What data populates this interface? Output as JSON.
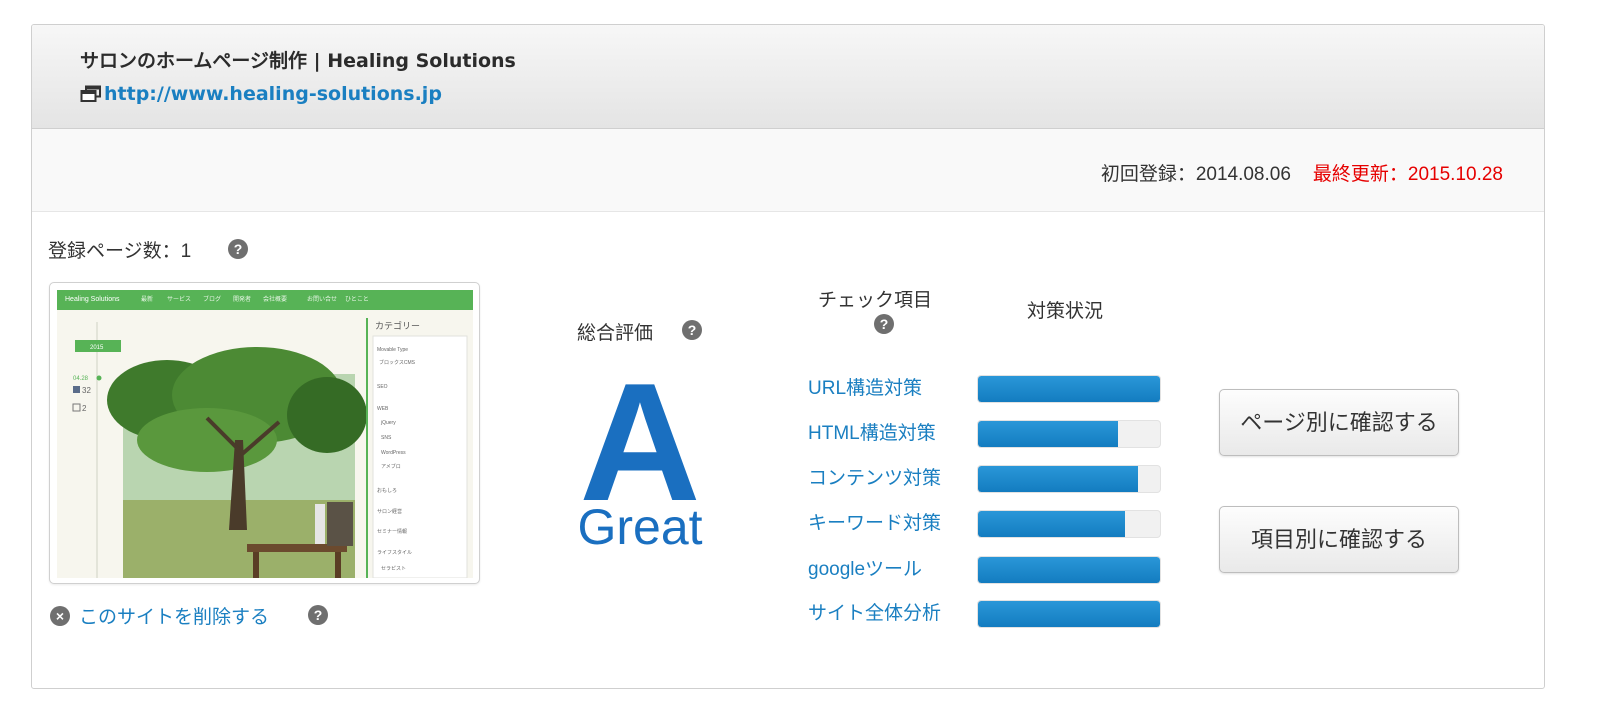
{
  "header": {
    "site_title": "サロンのホームページ制作 | Healing Solutions",
    "site_url": "http://www.healing-solutions.jp"
  },
  "dates": {
    "first_registered": "初回登録：2014.08.06",
    "last_updated": "最終更新：2015.10.28"
  },
  "summary": {
    "page_count_label": "登録ページ数：1",
    "delete_link": "このサイトを削除する",
    "help_glyph": "?",
    "delete_glyph": "×"
  },
  "thumbnail": {
    "menu": [
      "Healing Solutions",
      "最新",
      "サービス",
      "ブログ",
      "開発者",
      "会社概要",
      "お問い合せ",
      "ひとこと"
    ],
    "year": "2015",
    "date": "04.28",
    "fb_count": "32",
    "comment_count": "2",
    "category_title": "カテゴリー",
    "categories": [
      "Movable Type",
      "ブロックスCMS",
      "SEO",
      "WEB",
      "jQuery",
      "SNS",
      "WordPress",
      "アメブロ",
      "おもしろ",
      "サロン経営",
      "セミナー情報",
      "ライフスタイル",
      "セラピスト"
    ]
  },
  "overall": {
    "label": "総合評価",
    "grade": "A",
    "grade_word": "Great"
  },
  "checks": {
    "header_label": "チェック項目",
    "status_label": "対策状況",
    "items": [
      {
        "label": "URL構造対策",
        "progress": 1.0
      },
      {
        "label": "HTML構造対策",
        "progress": 0.77
      },
      {
        "label": "コンテンツ対策",
        "progress": 0.88
      },
      {
        "label": "キーワード対策",
        "progress": 0.81
      },
      {
        "label": "googleツール",
        "progress": 1.0
      },
      {
        "label": "サイト全体分析",
        "progress": 1.0
      }
    ]
  },
  "buttons": {
    "by_page": "ページ別に確認する",
    "by_item": "項目別に確認する"
  },
  "colors": {
    "link": "#1a7fc1",
    "grade": "#1a6fc0",
    "last_updated": "#e60000",
    "bar": "#1a86cc"
  }
}
